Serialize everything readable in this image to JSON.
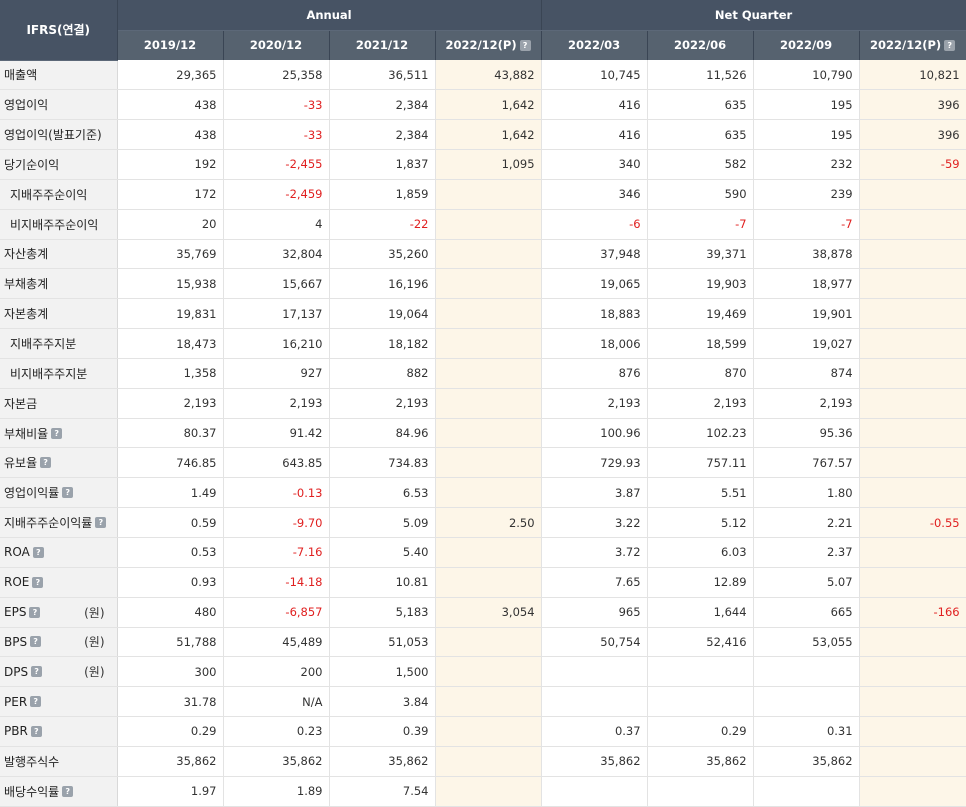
{
  "header": {
    "corner_label": "IFRS(연결)",
    "annual_label": "Annual",
    "quarter_label": "Net Quarter",
    "periods": [
      "2019/12",
      "2020/12",
      "2021/12",
      "2022/12(P)",
      "2022/03",
      "2022/06",
      "2022/09",
      "2022/12(P)"
    ]
  },
  "rows": [
    {
      "label": "매출액",
      "indent": false,
      "help": false,
      "unit": "",
      "values": [
        "29,365",
        "25,358",
        "36,511",
        "43,882",
        "10,745",
        "11,526",
        "10,790",
        "10,821"
      ]
    },
    {
      "label": "영업이익",
      "indent": false,
      "help": false,
      "unit": "",
      "values": [
        "438",
        "-33",
        "2,384",
        "1,642",
        "416",
        "635",
        "195",
        "396"
      ]
    },
    {
      "label": "영업이익(발표기준)",
      "indent": false,
      "help": false,
      "unit": "",
      "values": [
        "438",
        "-33",
        "2,384",
        "1,642",
        "416",
        "635",
        "195",
        "396"
      ]
    },
    {
      "label": "당기순이익",
      "indent": false,
      "help": false,
      "unit": "",
      "values": [
        "192",
        "-2,455",
        "1,837",
        "1,095",
        "340",
        "582",
        "232",
        "-59"
      ]
    },
    {
      "label": "지배주주순이익",
      "indent": true,
      "help": false,
      "unit": "",
      "values": [
        "172",
        "-2,459",
        "1,859",
        "",
        "346",
        "590",
        "239",
        ""
      ]
    },
    {
      "label": "비지배주주순이익",
      "indent": true,
      "help": false,
      "unit": "",
      "values": [
        "20",
        "4",
        "-22",
        "",
        "-6",
        "-7",
        "-7",
        ""
      ]
    },
    {
      "label": "자산총계",
      "indent": false,
      "help": false,
      "unit": "",
      "values": [
        "35,769",
        "32,804",
        "35,260",
        "",
        "37,948",
        "39,371",
        "38,878",
        ""
      ]
    },
    {
      "label": "부채총계",
      "indent": false,
      "help": false,
      "unit": "",
      "values": [
        "15,938",
        "15,667",
        "16,196",
        "",
        "19,065",
        "19,903",
        "18,977",
        ""
      ]
    },
    {
      "label": "자본총계",
      "indent": false,
      "help": false,
      "unit": "",
      "values": [
        "19,831",
        "17,137",
        "19,064",
        "",
        "18,883",
        "19,469",
        "19,901",
        ""
      ]
    },
    {
      "label": "지배주주지분",
      "indent": true,
      "help": false,
      "unit": "",
      "values": [
        "18,473",
        "16,210",
        "18,182",
        "",
        "18,006",
        "18,599",
        "19,027",
        ""
      ]
    },
    {
      "label": "비지배주주지분",
      "indent": true,
      "help": false,
      "unit": "",
      "values": [
        "1,358",
        "927",
        "882",
        "",
        "876",
        "870",
        "874",
        ""
      ]
    },
    {
      "label": "자본금",
      "indent": false,
      "help": false,
      "unit": "",
      "values": [
        "2,193",
        "2,193",
        "2,193",
        "",
        "2,193",
        "2,193",
        "2,193",
        ""
      ]
    },
    {
      "label": "부채비율",
      "indent": false,
      "help": true,
      "unit": "",
      "values": [
        "80.37",
        "91.42",
        "84.96",
        "",
        "100.96",
        "102.23",
        "95.36",
        ""
      ]
    },
    {
      "label": "유보율",
      "indent": false,
      "help": true,
      "unit": "",
      "values": [
        "746.85",
        "643.85",
        "734.83",
        "",
        "729.93",
        "757.11",
        "767.57",
        ""
      ]
    },
    {
      "label": "영업이익률",
      "indent": false,
      "help": true,
      "unit": "",
      "values": [
        "1.49",
        "-0.13",
        "6.53",
        "",
        "3.87",
        "5.51",
        "1.80",
        ""
      ]
    },
    {
      "label": "지배주주순이익률",
      "indent": false,
      "help": true,
      "unit": "",
      "values": [
        "0.59",
        "-9.70",
        "5.09",
        "2.50",
        "3.22",
        "5.12",
        "2.21",
        "-0.55"
      ]
    },
    {
      "label": "ROA",
      "indent": false,
      "help": true,
      "unit": "",
      "values": [
        "0.53",
        "-7.16",
        "5.40",
        "",
        "3.72",
        "6.03",
        "2.37",
        ""
      ]
    },
    {
      "label": "ROE",
      "indent": false,
      "help": true,
      "unit": "",
      "values": [
        "0.93",
        "-14.18",
        "10.81",
        "",
        "7.65",
        "12.89",
        "5.07",
        ""
      ]
    },
    {
      "label": "EPS",
      "indent": false,
      "help": true,
      "unit": "(원)",
      "values": [
        "480",
        "-6,857",
        "5,183",
        "3,054",
        "965",
        "1,644",
        "665",
        "-166"
      ]
    },
    {
      "label": "BPS",
      "indent": false,
      "help": true,
      "unit": "(원)",
      "values": [
        "51,788",
        "45,489",
        "51,053",
        "",
        "50,754",
        "52,416",
        "53,055",
        ""
      ]
    },
    {
      "label": "DPS",
      "indent": false,
      "help": true,
      "unit": "(원)",
      "values": [
        "300",
        "200",
        "1,500",
        "",
        "",
        "",
        "",
        ""
      ]
    },
    {
      "label": "PER",
      "indent": false,
      "help": true,
      "unit": "",
      "values": [
        "31.78",
        "N/A",
        "3.84",
        "",
        "",
        "",
        "",
        ""
      ]
    },
    {
      "label": "PBR",
      "indent": false,
      "help": true,
      "unit": "",
      "values": [
        "0.29",
        "0.23",
        "0.39",
        "",
        "0.37",
        "0.29",
        "0.31",
        ""
      ]
    },
    {
      "label": "발행주식수",
      "indent": false,
      "help": false,
      "unit": "",
      "values": [
        "35,862",
        "35,862",
        "35,862",
        "",
        "35,862",
        "35,862",
        "35,862",
        ""
      ]
    },
    {
      "label": "배당수익률",
      "indent": false,
      "help": true,
      "unit": "",
      "values": [
        "1.97",
        "1.89",
        "7.54",
        "",
        "",
        "",
        "",
        ""
      ]
    }
  ]
}
